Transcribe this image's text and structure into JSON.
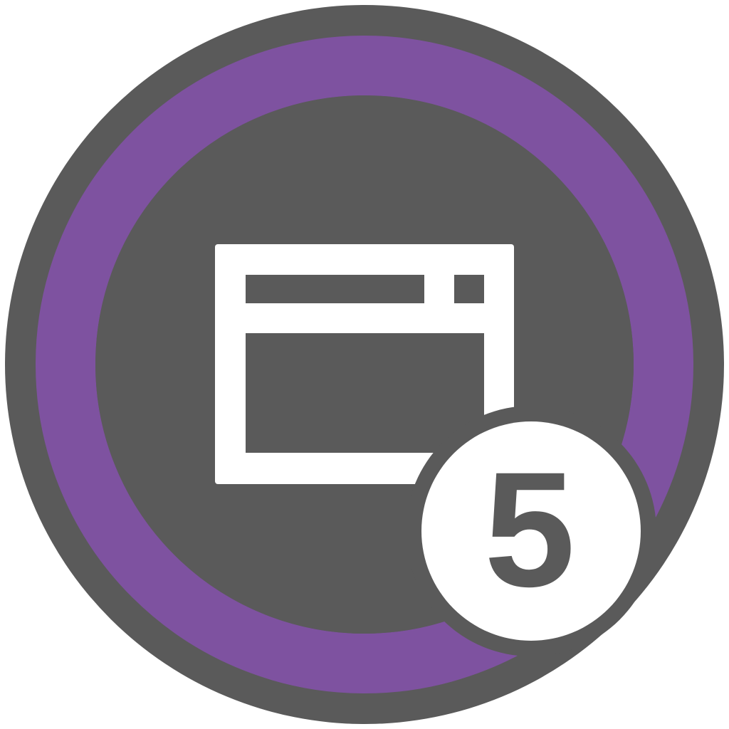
{
  "icon": {
    "name": "browser-window-icon",
    "badge_number": "5"
  },
  "colors": {
    "outer_ring": "#5a5a5a",
    "progress_ring": "#7e52a0",
    "inner_disc": "#5a5a5a",
    "glyph": "#ffffff",
    "badge_fill": "#ffffff",
    "badge_border": "#5a5a5a",
    "badge_text": "#5a5a5a"
  }
}
